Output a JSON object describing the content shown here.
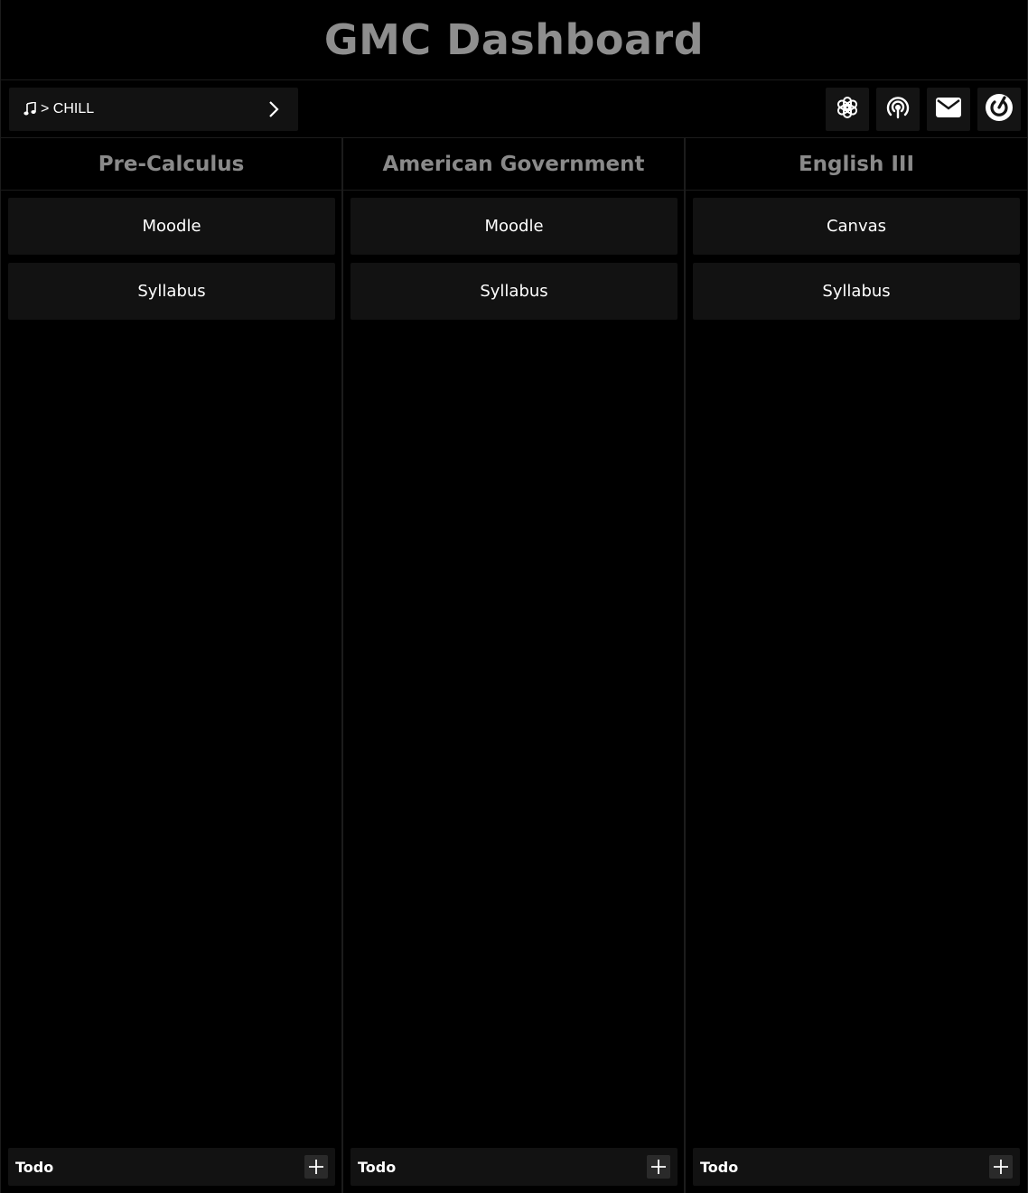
{
  "header": {
    "title": "GMC Dashboard"
  },
  "music": {
    "label": "> CHILL",
    "icon": "music-note-icon"
  },
  "toolbar_icons": [
    "openai-icon",
    "podcast-icon",
    "mail-icon",
    "power-icon"
  ],
  "columns": [
    {
      "title": "Pre-Calculus",
      "links": [
        "Moodle",
        "Syllabus"
      ],
      "todo_label": "Todo"
    },
    {
      "title": "American Government",
      "links": [
        "Moodle",
        "Syllabus"
      ],
      "todo_label": "Todo"
    },
    {
      "title": "English III",
      "links": [
        "Canvas",
        "Syllabus"
      ],
      "todo_label": "Todo"
    }
  ]
}
